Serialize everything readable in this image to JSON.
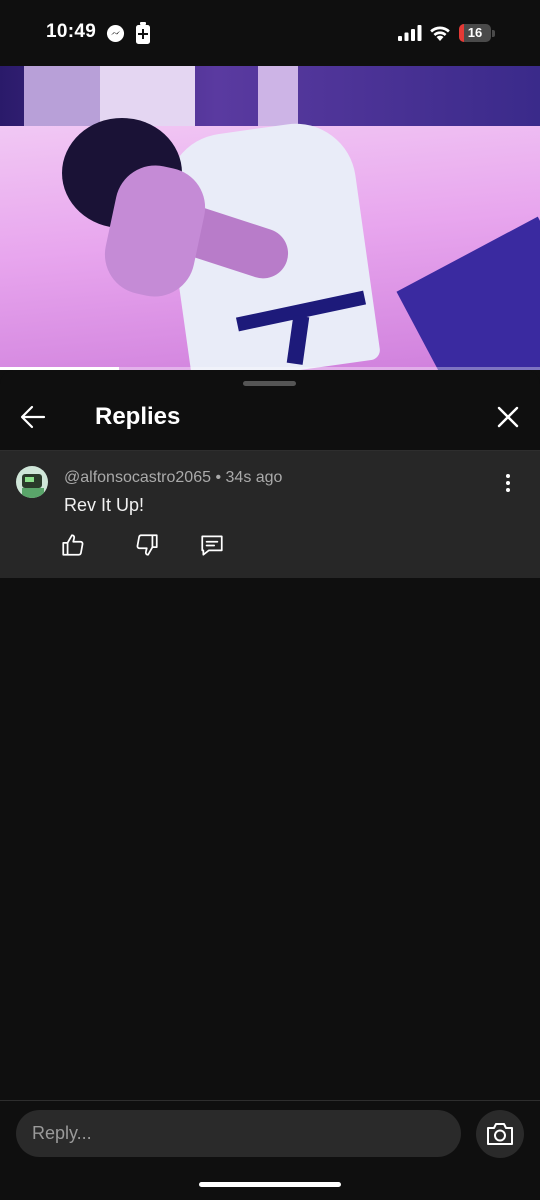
{
  "status_bar": {
    "time": "10:49",
    "battery_level": "16",
    "battery_fraction": 0.16,
    "icons": [
      "messenger-icon",
      "battery-saver-icon",
      "signal-icon",
      "wifi-icon",
      "battery-icon"
    ]
  },
  "video": {
    "progress_fraction": 0.22
  },
  "sheet": {
    "title": "Replies",
    "back_icon": "arrow-left-icon",
    "close_icon": "close-icon"
  },
  "comment": {
    "author": "@alfonsocastro2065",
    "separator": "•",
    "time_ago": "34s ago",
    "text": "Rev It Up!",
    "actions": [
      "thumb-up-icon",
      "thumb-down-icon",
      "comment-reply-icon"
    ],
    "more_icon": "more-vertical-icon"
  },
  "reply_bar": {
    "placeholder": "Reply...",
    "camera_icon": "camera-icon"
  },
  "colors": {
    "background": "#0f0f0f",
    "comment_background": "#272727",
    "input_background": "#2a2a2a",
    "battery_low": "#e53935"
  }
}
